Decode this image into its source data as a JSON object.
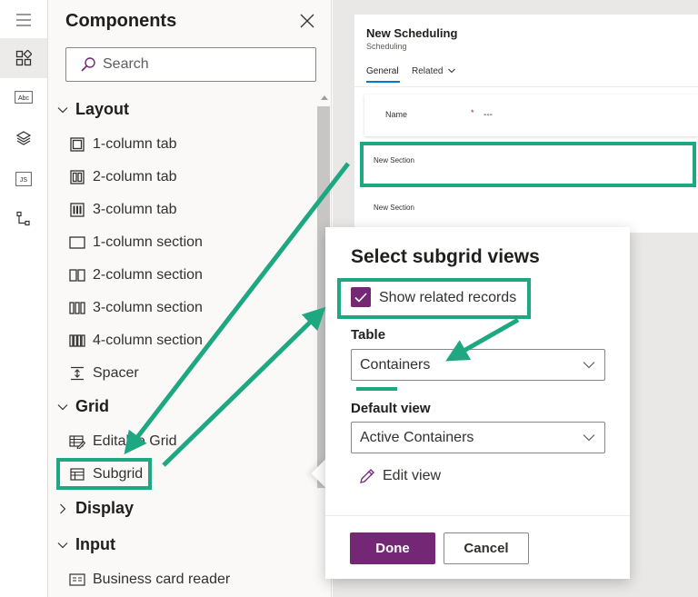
{
  "rail": {
    "items": [
      {
        "icon": "hamburger-menu-icon"
      },
      {
        "icon": "components-icon",
        "active": true
      },
      {
        "icon": "table-columns-icon",
        "text": "Abc"
      },
      {
        "icon": "layers-icon"
      },
      {
        "icon": "javascript-icon",
        "text": "JS"
      },
      {
        "icon": "tree-view-icon"
      }
    ]
  },
  "panel": {
    "title": "Components",
    "search_placeholder": "Search",
    "sections": {
      "layout": {
        "label": "Layout",
        "items": [
          "1-column tab",
          "2-column tab",
          "3-column tab",
          "1-column section",
          "2-column section",
          "3-column section",
          "4-column section",
          "Spacer"
        ]
      },
      "grid": {
        "label": "Grid",
        "items": [
          "Editable Grid",
          "Subgrid"
        ]
      },
      "display": {
        "label": "Display"
      },
      "input": {
        "label": "Input",
        "items": [
          "Business card reader"
        ]
      }
    }
  },
  "form": {
    "title": "New Scheduling",
    "subtitle": "Scheduling",
    "tabs": [
      "General",
      "Related"
    ],
    "name_label": "Name",
    "required_mark": "*",
    "name_value": "---",
    "section1_label": "New Section",
    "section2_label": "New Section"
  },
  "popup": {
    "title": "Select subgrid views",
    "checkbox_label": "Show related records",
    "checkbox_checked": true,
    "table_label": "Table",
    "table_value": "Containers",
    "default_view_label": "Default view",
    "default_view_value": "Active Containers",
    "edit_view_label": "Edit view",
    "done_label": "Done",
    "cancel_label": "Cancel"
  },
  "colors": {
    "accent_purple": "#742774",
    "annotation_green": "#1ea882",
    "tab_underline": "#0078d4"
  }
}
